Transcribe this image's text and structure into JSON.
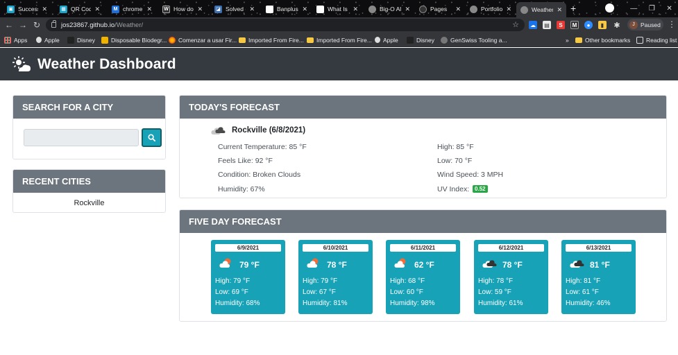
{
  "browser": {
    "tabs": [
      {
        "label": "Success",
        "icon": "teal-square-icon",
        "color": "#1aa3c9"
      },
      {
        "label": "QR Code",
        "icon": "qr-icon",
        "color": "#1aa3c9"
      },
      {
        "label": "chrome",
        "icon": "m-icon",
        "color": "#1e6fd9"
      },
      {
        "label": "How do I",
        "icon": "w-icon",
        "color": "#333333"
      },
      {
        "label": "Solved -",
        "icon": "solved-icon",
        "color": "#3c6fb0"
      },
      {
        "label": "Banplus",
        "icon": "page-icon",
        "color": "#ffffff"
      },
      {
        "label": "What Is",
        "icon": "page-icon",
        "color": "#ffffff"
      },
      {
        "label": "Big-O Al",
        "icon": "globe-icon",
        "color": "#888888"
      },
      {
        "label": "Pages",
        "icon": "github-icon",
        "color": "#333333"
      },
      {
        "label": "Portfolio",
        "icon": "globe-icon",
        "color": "#888888"
      },
      {
        "label": "Weather",
        "icon": "globe-icon",
        "color": "#888888"
      }
    ],
    "close_glyph": "✕",
    "new_tab_glyph": "+",
    "url_host": "jos23867.github.io",
    "url_path": "/Weather/",
    "profile_initial": "J",
    "profile_label": "Paused",
    "bookmarks": [
      {
        "label": "Apps",
        "icon": "apps-grid-icon"
      },
      {
        "label": "Apple",
        "icon": "apple-icon"
      },
      {
        "label": "Disney",
        "icon": "disney-icon"
      },
      {
        "label": "Disposable Biodegr...",
        "icon": "bookmark-icon"
      },
      {
        "label": "Comenzar a usar Fir...",
        "icon": "firefox-icon"
      },
      {
        "label": "Imported From Fire...",
        "icon": "folder-icon"
      },
      {
        "label": "Imported From Fire...",
        "icon": "folder-icon"
      },
      {
        "label": "Apple",
        "icon": "apple-icon"
      },
      {
        "label": "Disney",
        "icon": "disney-icon"
      },
      {
        "label": "GenSwiss Tooling a...",
        "icon": "globe-icon"
      }
    ],
    "bookmarks_more": "»",
    "other_bookmarks": "Other bookmarks",
    "reading_list": "Reading list"
  },
  "header": {
    "title": "Weather Dashboard"
  },
  "search": {
    "title": "Search for a City",
    "value": "",
    "placeholder": ""
  },
  "recent": {
    "title": "Recent Cities",
    "cities": [
      "Rockville"
    ]
  },
  "today": {
    "title": "Today's Forecast",
    "city": "Rockville (6/8/2021)",
    "current_temp": "Current Temperature: 85 °F",
    "feels_like": "Feels Like: 92 °F",
    "condition": "Condition: Broken Clouds",
    "humidity": "Humidity: 67%",
    "high": "High: 85 °F",
    "low": "Low: 70 °F",
    "wind": "Wind Speed: 3 MPH",
    "uv_label": "UV Index:",
    "uv_value": "0.52",
    "uv_color": "#28a745"
  },
  "five_day": {
    "title": "Five Day Forecast",
    "days": [
      {
        "date": "6/9/2021",
        "temp": "79 °F",
        "high": "High: 79 °F",
        "low": "Low: 69 °F",
        "humidity": "Humidity: 68%",
        "icon": "sun-cloud-icon"
      },
      {
        "date": "6/10/2021",
        "temp": "78 °F",
        "high": "High: 79 °F",
        "low": "Low: 67 °F",
        "humidity": "Humidity: 81%",
        "icon": "sun-cloud-icon"
      },
      {
        "date": "6/11/2021",
        "temp": "62 °F",
        "high": "High: 68 °F",
        "low": "Low: 60 °F",
        "humidity": "Humidity: 98%",
        "icon": "sun-cloud-icon"
      },
      {
        "date": "6/12/2021",
        "temp": "78 °F",
        "high": "High: 78 °F",
        "low": "Low: 59 °F",
        "humidity": "Humidity: 61%",
        "icon": "dark-clouds-icon"
      },
      {
        "date": "6/13/2021",
        "temp": "81 °F",
        "high": "High: 81 °F",
        "low": "Low: 61 °F",
        "humidity": "Humidity: 46%",
        "icon": "dark-clouds-icon"
      }
    ]
  },
  "colors": {
    "header_bg": "#343a40",
    "card_header_bg": "#6c757d",
    "accent": "#17a2b8"
  }
}
